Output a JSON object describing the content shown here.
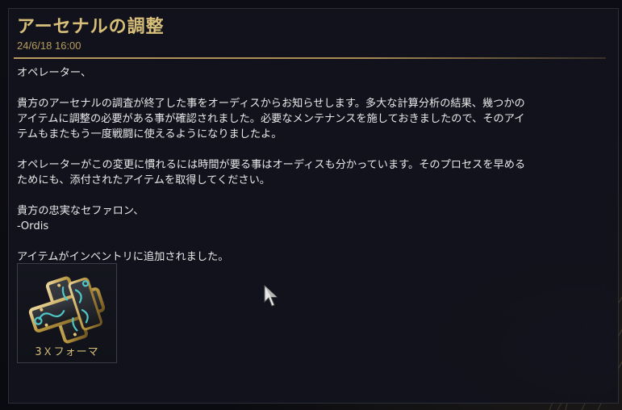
{
  "message": {
    "title": "アーセナルの調整",
    "timestamp": "24/6/18 16:00",
    "paragraphs": [
      "オペレーター、",
      "貴方のアーセナルの調査が終了した事をオーディスからお知らせします。多大な計算分析の結果、幾つかの\nアイテムに調整の必要がある事が確認されました。必要なメンテナンスを施しておきましたので、そのアイ\nテムもまたもう一度戦闘に使えるようになりましたよ。",
      "オペレーターがこの変更に慣れるには時間が要る事はオーディスも分かっています。そのプロセスを早める\nためにも、添付されたアイテムを取得してください。",
      "貴方の忠実なセファロン、\n-Ordis",
      "アイテムがインベントリに追加されました。"
    ]
  },
  "attachment": {
    "icon": "forma-icon",
    "label": "3Ｘフォーマ"
  },
  "colors": {
    "title_gold": "#d8bf7a",
    "divider_gold": "#b89c5e",
    "body_text": "#e8e8ea",
    "panel_bg": "#12131c",
    "forma_teal": "#4fc7c9"
  }
}
